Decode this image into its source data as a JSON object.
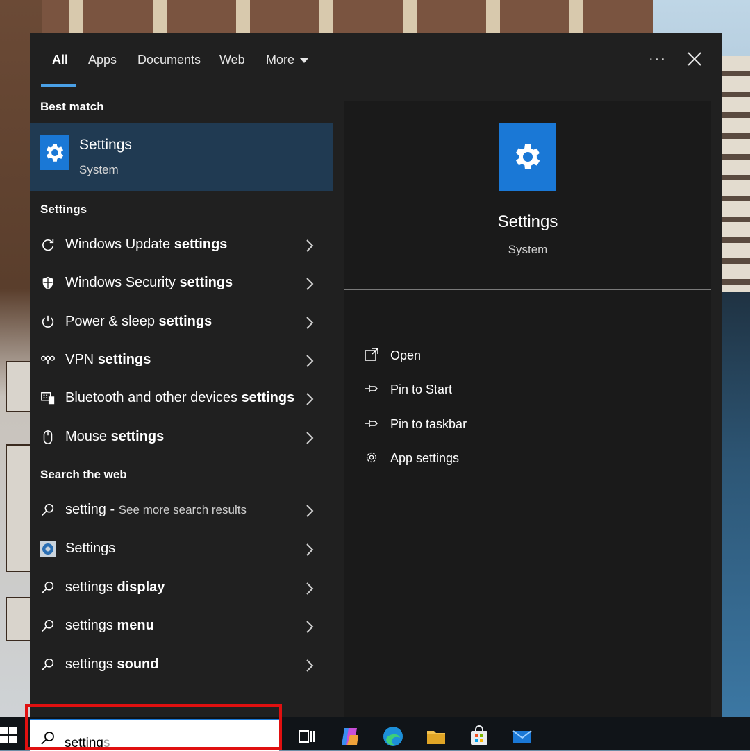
{
  "tabs": [
    {
      "label": "All",
      "active": true
    },
    {
      "label": "Apps"
    },
    {
      "label": "Documents"
    },
    {
      "label": "Web"
    },
    {
      "label": "More"
    }
  ],
  "sections": {
    "best_match": "Best match",
    "settings": "Settings",
    "search_web": "Search the web"
  },
  "best_match": {
    "title": "Settings",
    "subtitle": "System",
    "icon": "gear-icon"
  },
  "settings_results": [
    {
      "prefix": "Windows Update ",
      "bold": "settings",
      "icon": "refresh-icon"
    },
    {
      "prefix": "Windows Security ",
      "bold": "settings",
      "icon": "shield-icon"
    },
    {
      "prefix": "Power & sleep ",
      "bold": "settings",
      "icon": "power-icon"
    },
    {
      "prefix": "VPN ",
      "bold": "settings",
      "icon": "vpn-icon"
    },
    {
      "prefix": "Bluetooth and other devices ",
      "bold": "settings",
      "icon": "devices-icon"
    },
    {
      "prefix": "Mouse ",
      "bold": "settings",
      "icon": "mouse-icon"
    }
  ],
  "web_results": [
    {
      "prefix": "setting",
      "sep": " - ",
      "sub": "See more search results",
      "icon": "search-icon"
    },
    {
      "prefix": "Settings",
      "icon": "settings-app-icon"
    },
    {
      "prefix": "settings ",
      "bold": "display",
      "icon": "search-icon"
    },
    {
      "prefix": "settings ",
      "bold": "menu",
      "icon": "search-icon"
    },
    {
      "prefix": "settings ",
      "bold": "sound",
      "icon": "search-icon"
    }
  ],
  "preview": {
    "title": "Settings",
    "subtitle": "System"
  },
  "actions": [
    {
      "label": "Open",
      "icon": "open-icon"
    },
    {
      "label": "Pin to Start",
      "icon": "pin-icon"
    },
    {
      "label": "Pin to taskbar",
      "icon": "pin-icon"
    },
    {
      "label": "App settings",
      "icon": "gear-icon"
    }
  ],
  "search": {
    "typed": "setting",
    "suggestion_tail": "s"
  },
  "colors": {
    "accent": "#1a78d6",
    "panel": "#202020",
    "selected": "#203a52",
    "highlight": "#e01010"
  }
}
